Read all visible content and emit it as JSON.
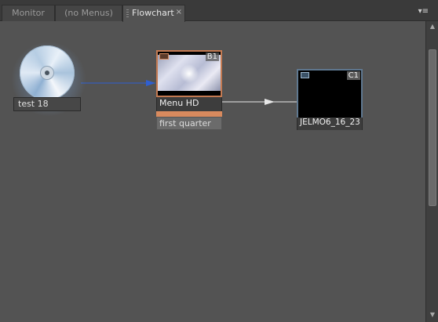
{
  "tabs": [
    {
      "label": "Monitor",
      "active": false
    },
    {
      "label": "(no Menus)",
      "active": false
    },
    {
      "label": "Flowchart",
      "active": true
    }
  ],
  "tab_close_glyph": "×",
  "panel_menu_glyph": "▾≡",
  "colors": {
    "link_first_play": "#2f5fd1",
    "link_button": "#e8e8e8",
    "menu_accent": "#d88a5e",
    "clip_border": "#5f7890"
  },
  "disc": {
    "label": "test 18",
    "icon": "dvd-disc-icon"
  },
  "menu": {
    "badge": "B1",
    "label": "Menu HD",
    "icon": "menu-icon",
    "buttons": [
      {
        "label": "first quarter"
      }
    ]
  },
  "timeline": {
    "badge": "C1",
    "label": "JELMO6_16_23",
    "icon": "timeline-icon"
  },
  "scrollbar": {
    "up_glyph": "▲",
    "down_glyph": "▼"
  }
}
